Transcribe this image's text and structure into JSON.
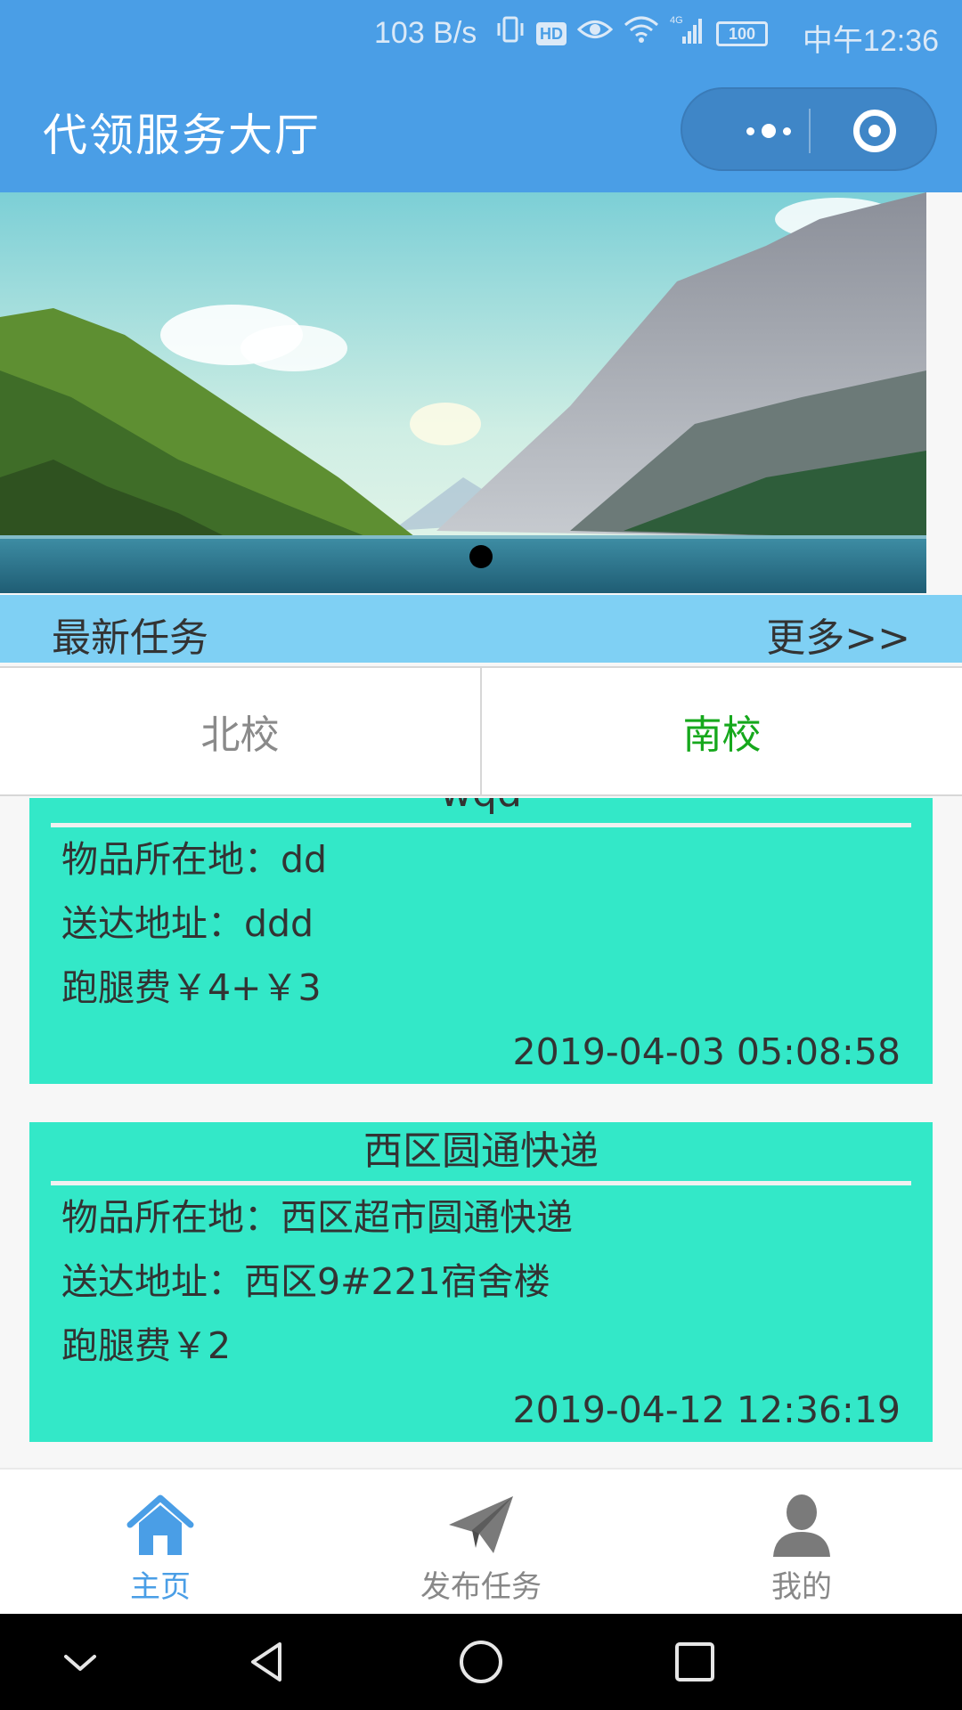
{
  "status_bar": {
    "speed": "103 B/s",
    "time": "中午12:36",
    "hd_label": "HD",
    "network_label": "4G",
    "battery": "100",
    "icons": [
      "vibrate-icon",
      "hd-icon",
      "eye-icon",
      "wifi-icon",
      "signal-icon",
      "battery-icon"
    ]
  },
  "nav": {
    "title": "代领服务大厅"
  },
  "banner": {
    "image": "mountain-lake-image",
    "indicator_count": 1,
    "active_index": 0
  },
  "section": {
    "title": "最新任务",
    "more": "更多>>"
  },
  "tabs": [
    {
      "label": "北校",
      "active": false
    },
    {
      "label": "南校",
      "active": true
    }
  ],
  "tasks": [
    {
      "title": "wqd",
      "location": "物品所在地：dd",
      "address": "送达地址：ddd",
      "fee": "跑腿费￥4+￥3",
      "time": "2019-04-03 05:08:58"
    },
    {
      "title": "西区圆通快递",
      "location": "物品所在地：西区超市圆通快递",
      "address": "送达地址：西区9#221宿舍楼",
      "fee": "跑腿费￥2",
      "time": "2019-04-12 12:36:19"
    }
  ],
  "tab_bar": [
    {
      "label": "主页",
      "icon": "home-icon",
      "active": true
    },
    {
      "label": "发布任务",
      "icon": "paper-plane-icon",
      "active": false
    },
    {
      "label": "我的",
      "icon": "user-icon",
      "active": false
    }
  ],
  "colors": {
    "primary": "#4a9ee6",
    "section_bg": "#7fd0f4",
    "card_bg": "#33e8c8",
    "tab_active": "#16a81c"
  }
}
